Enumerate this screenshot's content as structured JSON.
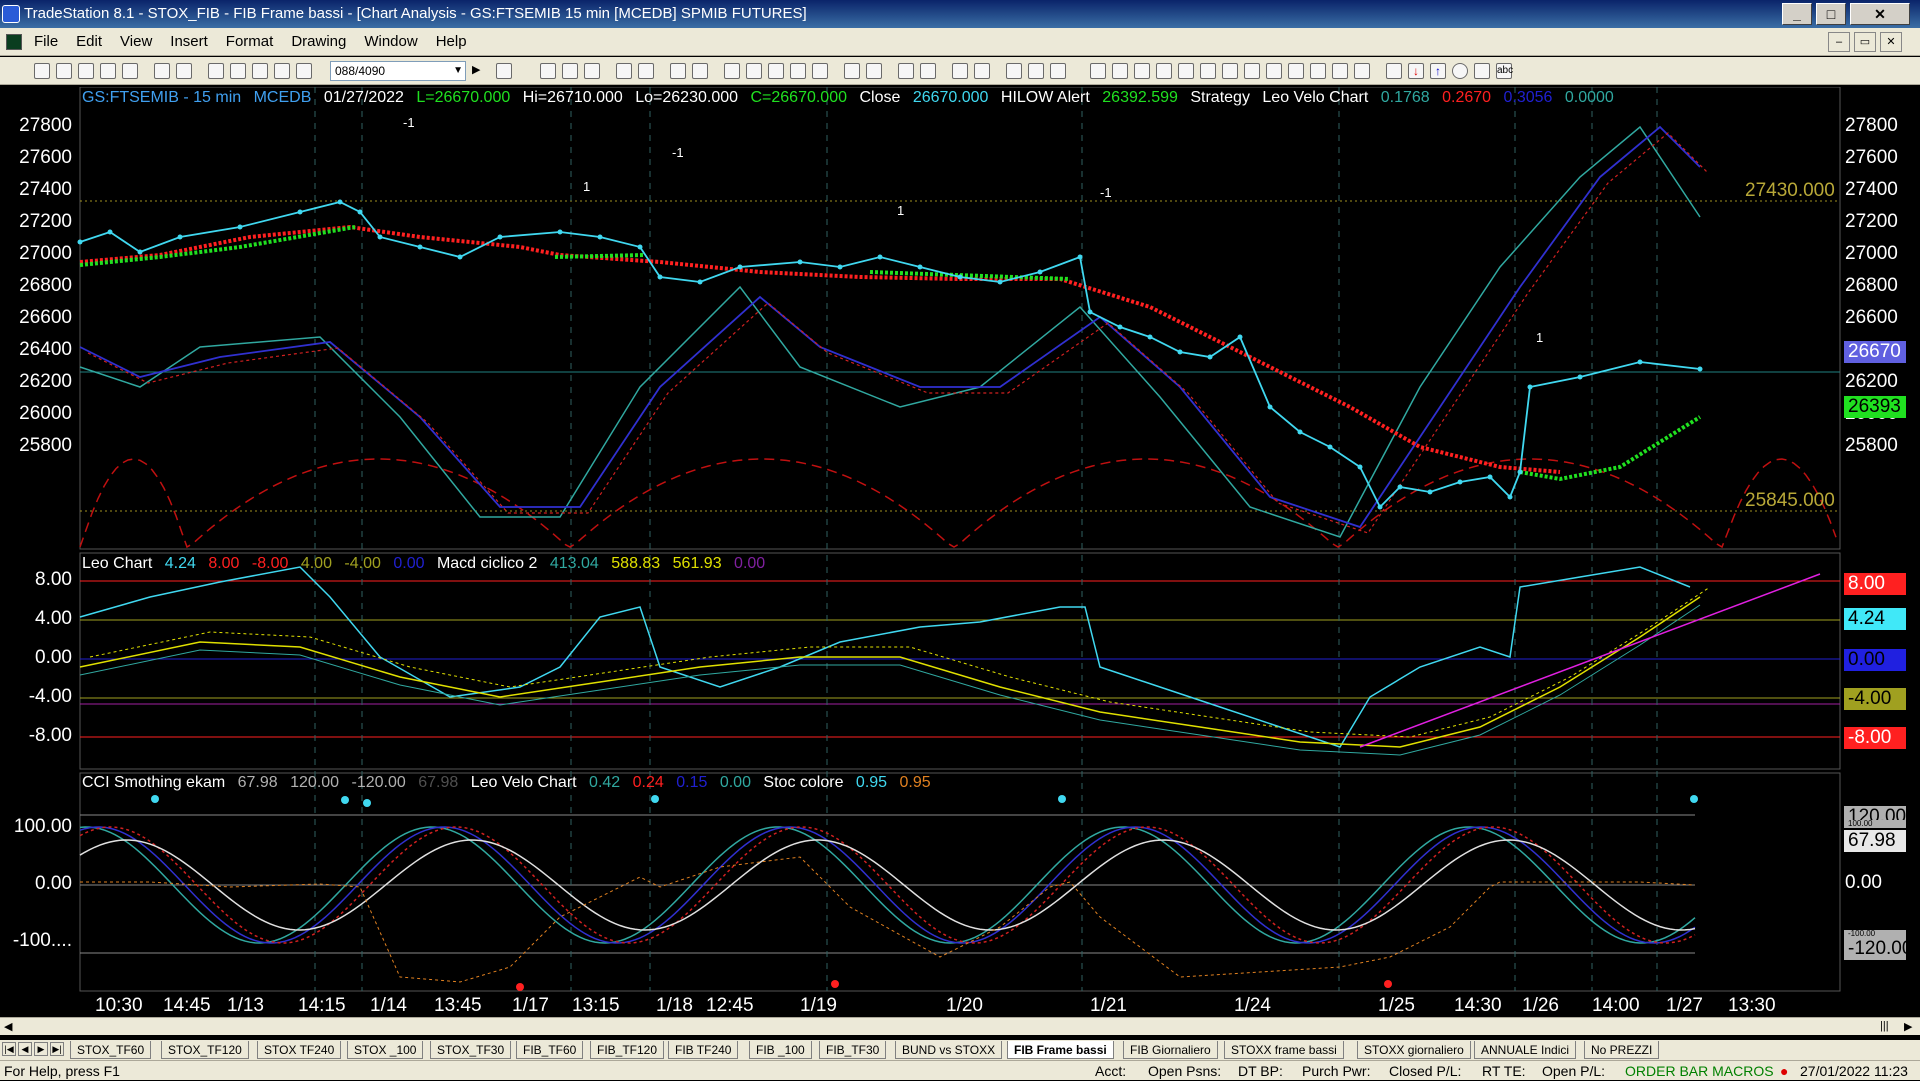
{
  "window": {
    "title": "TradeStation 8.1 - STOX_FIB - FIB Frame bassi - [Chart Analysis - GS:FTSEMIB  15 min  [MCEDB] SPMIB FUTURES]"
  },
  "menu": [
    "File",
    "Edit",
    "View",
    "Insert",
    "Format",
    "Drawing",
    "Window",
    "Help"
  ],
  "toolbar": {
    "symbol_value": "088/4090"
  },
  "panel1": {
    "symbol": "GS:FTSEMIB - 15 min",
    "source": "MCEDB",
    "date": "01/27/2022",
    "last": "L=26670.000",
    "hi": "Hi=26710.000",
    "lo": "Lo=26230.000",
    "close_eq": "C=26670.000",
    "close_label": "Close",
    "close_value": "26670.000",
    "hilow_label": "HILOW Alert",
    "hilow_value": "26392.599",
    "strategy_label": "Strategy",
    "velo_label": "Leo Velo Chart",
    "v1": "0.1768",
    "v2": "0.2670",
    "v3": "0.3056",
    "v4": "0.0000",
    "y_ticks": [
      "27800",
      "27600",
      "27400",
      "27200",
      "27000",
      "26800",
      "26600",
      "26400",
      "26200",
      "26000",
      "25800"
    ],
    "y_ticks_right": [
      "27800",
      "27600",
      "27400",
      "27200",
      "27000",
      "26800",
      "26600",
      "26400",
      "26200",
      "26000",
      "25800"
    ],
    "level_high": "27430.000",
    "level_low": "25845.000",
    "tag_price": "26670",
    "tag_hilow": "26393",
    "signals": [
      "-1",
      "1",
      "-1",
      "1",
      "-1",
      "1"
    ]
  },
  "panel2": {
    "name": "Leo Chart",
    "v1": "4.24",
    "v2": "8.00",
    "v3": "-8.00",
    "v4": "4.00",
    "v5": "-4.00",
    "v6": "0.00",
    "name2": "Macd ciclico 2",
    "m1": "413.04",
    "m2": "588.83",
    "m3": "561.93",
    "m4": "0.00",
    "y_ticks": [
      "8.00",
      "4.00",
      "0.00",
      "-4.00",
      "-8.00"
    ],
    "tags": [
      "8.00",
      "4.24",
      "0.00",
      "-4.00",
      "-8.00"
    ]
  },
  "panel3": {
    "name": "CCI Smothing ekam",
    "v1": "67.98",
    "v2": "120.00",
    "v3": "-120.00",
    "v4": "67.98",
    "name2": "Leo Velo Chart",
    "l1": "0.42",
    "l2": "0.24",
    "l3": "0.15",
    "l4": "0.00",
    "name3": "Stoc colore",
    "s1": "0.95",
    "s2": "0.95",
    "y_ticks": [
      "100.00",
      "0.00",
      "-100...."
    ],
    "tags": [
      "120.00",
      "100.00",
      "67.98",
      "0.00",
      "-100.00",
      "-120.00"
    ]
  },
  "x_ticks": [
    "10:30",
    "14:45",
    "1/13",
    "14:15",
    "1/14",
    "13:45",
    "1/17",
    "13:15",
    "1/18",
    "12:45",
    "1/19",
    "1/20",
    "1/21",
    "1/24",
    "1/25",
    "14:30",
    "1/26",
    "14:00",
    "1/27",
    "13:30"
  ],
  "tabs": [
    "STOX_TF60",
    "STOX_TF120",
    "STOX TF240",
    "STOX _100",
    "STOX_TF30",
    "FIB_TF60",
    "FIB_TF120",
    "FIB TF240",
    "FIB _100",
    "FIB_TF30",
    "BUND vs STOXX",
    "FIB Frame bassi",
    "FIB Giornaliero",
    "STOXX frame bassi",
    "STOXX giornaliero",
    "ANNUALE Indici",
    "No PREZZI"
  ],
  "status": {
    "help": "For Help, press F1",
    "acct": "Acct:",
    "open_psns": "Open Psns:",
    "dt_bp": "DT BP:",
    "purch_pwr": "Purch Pwr:",
    "closed_pl": "Closed P/L:",
    "rt_te": "RT TE:",
    "open_pl": "Open P/L:",
    "macros": "ORDER BAR  MACROS",
    "datetime": "27/01/2022 11:23"
  },
  "colors": {
    "cyan": "#40d8f0",
    "red": "#ff2020",
    "green": "#20e020",
    "teal": "#30a8a0",
    "navy": "#2020d0",
    "yellow": "#e0e000"
  }
}
